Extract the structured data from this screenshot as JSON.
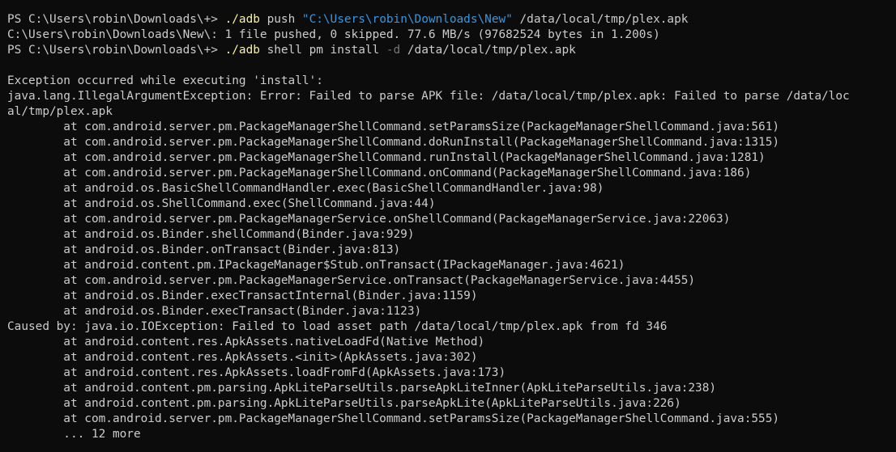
{
  "terminal": {
    "prompt": "PS C:\\Users\\robin\\Downloads\\+>",
    "cmd1": {
      "exe": "./adb",
      "args1": " push ",
      "path": "\"C:\\Users\\robin\\Downloads\\New\"",
      "args2": " /data/local/tmp/plex.apk"
    },
    "push_result": "C:\\Users\\robin\\Downloads\\New\\: 1 file pushed, 0 skipped. 77.6 MB/s (97682524 bytes in 1.200s)",
    "cmd2": {
      "exe": "./adb",
      "args1": " shell pm install ",
      "flag": "-d",
      "args2": " /data/local/tmp/plex.apk"
    },
    "output": [
      "",
      "Exception occurred while executing 'install':",
      "java.lang.IllegalArgumentException: Error: Failed to parse APK file: /data/local/tmp/plex.apk: Failed to parse /data/loc",
      "al/tmp/plex.apk",
      "        at com.android.server.pm.PackageManagerShellCommand.setParamsSize(PackageManagerShellCommand.java:561)",
      "        at com.android.server.pm.PackageManagerShellCommand.doRunInstall(PackageManagerShellCommand.java:1315)",
      "        at com.android.server.pm.PackageManagerShellCommand.runInstall(PackageManagerShellCommand.java:1281)",
      "        at com.android.server.pm.PackageManagerShellCommand.onCommand(PackageManagerShellCommand.java:186)",
      "        at android.os.BasicShellCommandHandler.exec(BasicShellCommandHandler.java:98)",
      "        at android.os.ShellCommand.exec(ShellCommand.java:44)",
      "        at com.android.server.pm.PackageManagerService.onShellCommand(PackageManagerService.java:22063)",
      "        at android.os.Binder.shellCommand(Binder.java:929)",
      "        at android.os.Binder.onTransact(Binder.java:813)",
      "        at android.content.pm.IPackageManager$Stub.onTransact(IPackageManager.java:4621)",
      "        at com.android.server.pm.PackageManagerService.onTransact(PackageManagerService.java:4455)",
      "        at android.os.Binder.execTransactInternal(Binder.java:1159)",
      "        at android.os.Binder.execTransact(Binder.java:1123)",
      "Caused by: java.io.IOException: Failed to load asset path /data/local/tmp/plex.apk from fd 346",
      "        at android.content.res.ApkAssets.nativeLoadFd(Native Method)",
      "        at android.content.res.ApkAssets.<init>(ApkAssets.java:302)",
      "        at android.content.res.ApkAssets.loadFromFd(ApkAssets.java:173)",
      "        at android.content.pm.parsing.ApkLiteParseUtils.parseApkLiteInner(ApkLiteParseUtils.java:238)",
      "        at android.content.pm.parsing.ApkLiteParseUtils.parseApkLite(ApkLiteParseUtils.java:226)",
      "        at com.android.server.pm.PackageManagerShellCommand.setParamsSize(PackageManagerShellCommand.java:555)",
      "        ... 12 more"
    ],
    "colors": {
      "background": "#0c0c0c",
      "text": "#cccccc",
      "command": "#f9f1a5",
      "string": "#3a96dd",
      "flag": "#767676"
    }
  }
}
